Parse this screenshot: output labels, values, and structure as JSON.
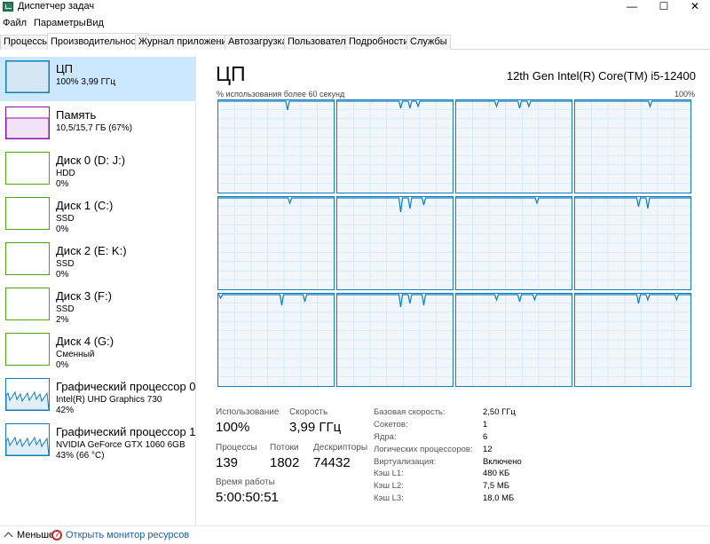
{
  "window": {
    "title": "Диспетчер задач",
    "controls": {
      "minimize": "—",
      "maximize": "☐",
      "close": "✕"
    }
  },
  "menu": [
    "Файл",
    "Параметры",
    "Вид"
  ],
  "tabs": [
    "Процессы",
    "Производительность",
    "Журнал приложений",
    "Автозагрузка",
    "Пользователи",
    "Подробности",
    "Службы"
  ],
  "active_tab": "Производительность",
  "sidebar": {
    "items": [
      {
        "name": "ЦП",
        "lines": [
          "100% 3,99 ГГц"
        ],
        "color": "#117dbb",
        "selected": true,
        "utilization": 1.0
      },
      {
        "name": "Память",
        "lines": [
          "10,5/15,7 ГБ (67%)"
        ],
        "color": "#8b12ae",
        "selected": false,
        "utilization": 0.67
      },
      {
        "name": "Диск 0 (D: J:)",
        "lines": [
          "HDD",
          "0%"
        ],
        "color": "#4da60c",
        "selected": false,
        "utilization": 0.0
      },
      {
        "name": "Диск 1 (C:)",
        "lines": [
          "SSD",
          "0%"
        ],
        "color": "#4da60c",
        "selected": false,
        "utilization": 0.0
      },
      {
        "name": "Диск 2 (E: K:)",
        "lines": [
          "SSD",
          "0%"
        ],
        "color": "#4da60c",
        "selected": false,
        "utilization": 0.0
      },
      {
        "name": "Диск 3 (F:)",
        "lines": [
          "SSD",
          "2%"
        ],
        "color": "#4da60c",
        "selected": false,
        "utilization": 0.02
      },
      {
        "name": "Диск 4 (G:)",
        "lines": [
          "Сменный",
          "0%"
        ],
        "color": "#4da60c",
        "selected": false,
        "utilization": 0.0
      },
      {
        "name": "Графический процессор 0",
        "lines": [
          "Intel(R) UHD Graphics 730",
          "42%"
        ],
        "color": "#117dbb",
        "selected": false,
        "utilization": 0.42
      },
      {
        "name": "Графический процессор 1",
        "lines": [
          "NVIDIA GeForce GTX 1060 6GB",
          "43% (66 °C)"
        ],
        "color": "#117dbb",
        "selected": false,
        "utilization": 0.43
      }
    ]
  },
  "cpu": {
    "title": "ЦП",
    "model": "12th Gen Intel(R) Core(TM) i5-12400",
    "graph_caption": "% использования более 60 секунд",
    "graph_max": "100%",
    "graph_color": "#117dbb",
    "logical_processors_shown": 12,
    "stats": {
      "utilization": {
        "label": "Использование",
        "value": "100%"
      },
      "speed": {
        "label": "Скорость",
        "value": "3,99 ГГц"
      },
      "processes": {
        "label": "Процессы",
        "value": "139"
      },
      "threads": {
        "label": "Потоки",
        "value": "1802"
      },
      "handles": {
        "label": "Дескрипторы",
        "value": "74432"
      },
      "uptime": {
        "label": "Время работы",
        "value": "5:00:50:51"
      }
    },
    "specs": [
      {
        "label": "Базовая скорость:",
        "value": "2,50 ГГц"
      },
      {
        "label": "Сокетов:",
        "value": "1"
      },
      {
        "label": "Ядра:",
        "value": "6"
      },
      {
        "label": "Логических процессоров:",
        "value": "12"
      },
      {
        "label": "Виртуализация:",
        "value": "Включено"
      },
      {
        "label": "Кэш L1:",
        "value": "480 КБ"
      },
      {
        "label": "Кэш L2:",
        "value": "7,5 МБ"
      },
      {
        "label": "Кэш L3:",
        "value": "18,0 МБ"
      }
    ]
  },
  "footer": {
    "toggle_label": "Меньше",
    "monitor_link": "Открыть монитор ресурсов"
  }
}
